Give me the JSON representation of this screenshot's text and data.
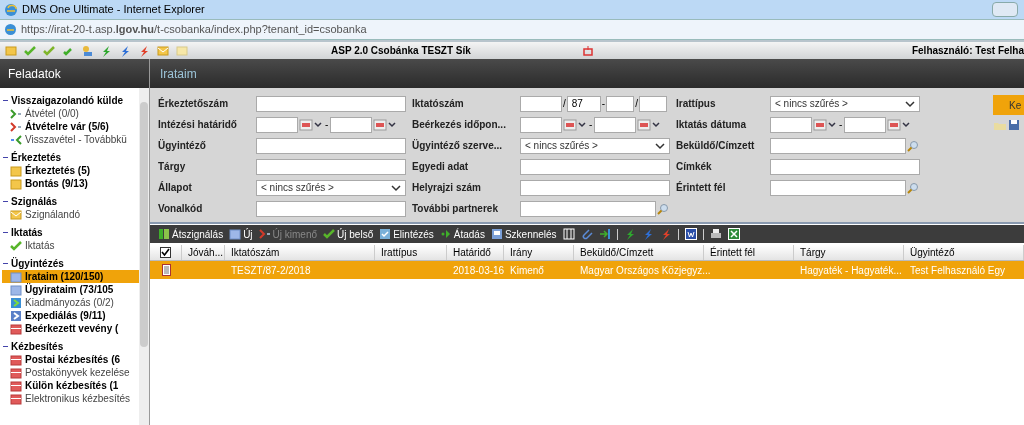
{
  "window": {
    "title": "DMS One Ultimate - Internet Explorer"
  },
  "address_bar": {
    "url": "https://irat-20-t.asp.**lgov.hu**/t-csobanka/index.php?tenant_id=csobanka"
  },
  "app_toolbar": {
    "center_title": "ASP 2.0 Csobánka TESZT Sík",
    "user": "Felhasználó: Test Felha"
  },
  "sidebar": {
    "title": "Feladatok",
    "groups": [
      {
        "title": "Visszaigazolandó külde",
        "items": [
          {
            "label": "Átvétel (0/0)",
            "kind": "in",
            "bold": false,
            "selected": false
          },
          {
            "label": "Átvételre vár (5/6)",
            "kind": "out",
            "bold": true,
            "selected": false
          },
          {
            "label": "Visszavétel - Továbbkü",
            "kind": "back",
            "bold": false,
            "selected": false
          }
        ]
      },
      {
        "title": "Érkeztetés",
        "items": [
          {
            "label": "Érkeztetés (5)",
            "kind": "folder",
            "bold": true,
            "selected": false
          },
          {
            "label": "Bontás (9/13)",
            "kind": "folder",
            "bold": true,
            "selected": false
          }
        ]
      },
      {
        "title": "Szignálás",
        "items": [
          {
            "label": "Szignálandó",
            "kind": "mail",
            "bold": false,
            "selected": false
          }
        ]
      },
      {
        "title": "Iktatás",
        "items": [
          {
            "label": "Iktatás",
            "kind": "check",
            "bold": false,
            "selected": false
          }
        ]
      },
      {
        "title": "Ügyintézés",
        "items": [
          {
            "label": "Irataim (120/150)",
            "kind": "doc",
            "bold": true,
            "selected": true
          },
          {
            "label": "Ügyirataim (73/105",
            "kind": "doc",
            "bold": true,
            "selected": false
          },
          {
            "label": "Kiadmányozás (0/2)",
            "kind": "go",
            "bold": false,
            "selected": false
          },
          {
            "label": "Expediálás (9/11)",
            "kind": "send",
            "bold": true,
            "selected": false
          },
          {
            "label": "Beérkezett vevény (",
            "kind": "red",
            "bold": true,
            "selected": false
          }
        ]
      },
      {
        "title": "Kézbesítés",
        "items": [
          {
            "label": "Postai kézbesítés (6",
            "kind": "red",
            "bold": true,
            "selected": false
          },
          {
            "label": "Postakönyvek kezelése",
            "kind": "red",
            "bold": false,
            "selected": false
          },
          {
            "label": "Külön kézbesítés (1",
            "kind": "red",
            "bold": true,
            "selected": false
          },
          {
            "label": "Elektronikus kézbesítés",
            "kind": "red",
            "bold": false,
            "selected": false
          }
        ]
      }
    ]
  },
  "content": {
    "title": "Irataim",
    "filter_rows": [
      [
        {
          "label": "Érkeztetőszám",
          "kind": "text"
        },
        {
          "label": "Iktatószám",
          "kind": "regno",
          "separators": [
            "/",
            "-",
            "/"
          ],
          "second_part": "87"
        },
        {
          "label": "Irattípus",
          "kind": "select",
          "value": "< nincs szűrés >"
        }
      ],
      [
        {
          "label": "Intézési határidő",
          "kind": "date_range",
          "sep": "-"
        },
        {
          "label": "Beérkezés időpon...",
          "kind": "date_range",
          "sep": "-"
        },
        {
          "label": "Iktatás dátuma",
          "kind": "date_range",
          "sep": "-"
        }
      ],
      [
        {
          "label": "Ügyintéző",
          "kind": "text"
        },
        {
          "label": "Ügyintéző szerve...",
          "kind": "select",
          "value": "< nincs szűrés >"
        },
        {
          "label": "Beküldő/Címzett",
          "kind": "lookup"
        }
      ],
      [
        {
          "label": "Tárgy",
          "kind": "text"
        },
        {
          "label": "Egyedi adat",
          "kind": "text"
        },
        {
          "label": "Címkék",
          "kind": "text"
        }
      ],
      [
        {
          "label": "Állapot",
          "kind": "select",
          "value": "< nincs szűrés >"
        },
        {
          "label": "Helyrajzi szám",
          "kind": "text"
        },
        {
          "label": "Érintett fél",
          "kind": "lookup"
        }
      ],
      [
        {
          "label": "Vonalkód",
          "kind": "text"
        },
        {
          "label": "További partnerek",
          "kind": "lookup"
        }
      ]
    ],
    "search_button": "Ke",
    "toolbar": [
      {
        "kind": "button",
        "label": "Átszignálás",
        "disabled": false
      },
      {
        "kind": "button",
        "label": "Új",
        "disabled": false
      },
      {
        "kind": "button",
        "label": "Új kimenő",
        "disabled": true
      },
      {
        "kind": "button",
        "label": "Új belső",
        "disabled": false
      },
      {
        "kind": "button",
        "label": "Elintézés",
        "disabled": false
      },
      {
        "kind": "button",
        "label": "Átadás",
        "disabled": false
      },
      {
        "kind": "button",
        "label": "Szkennelés",
        "disabled": false
      },
      {
        "kind": "icon"
      },
      {
        "kind": "icon"
      },
      {
        "kind": "icon"
      },
      {
        "kind": "separator"
      },
      {
        "kind": "icon"
      },
      {
        "kind": "icon"
      },
      {
        "kind": "icon"
      },
      {
        "kind": "separator"
      },
      {
        "kind": "icon"
      },
      {
        "kind": "separator"
      },
      {
        "kind": "icon"
      },
      {
        "kind": "icon"
      }
    ],
    "table": {
      "select_all_checked": true,
      "columns": [
        "Jóváh...",
        "Iktatószám",
        "Irattípus",
        "Határidő",
        "Irány",
        "Beküldő/Címzett",
        "Érintett fél",
        "Tárgy",
        "Ügyintéző"
      ],
      "rows": [
        {
          "selected": true,
          "cells": [
            null,
            "TESZT/87-2/2018",
            null,
            "2018-03-16",
            "Kimenő",
            "Magyar Országos Közjegyz...",
            null,
            "Hagyaték - Hagyaték...",
            "Test Felhasználó Egy"
          ]
        }
      ]
    }
  }
}
